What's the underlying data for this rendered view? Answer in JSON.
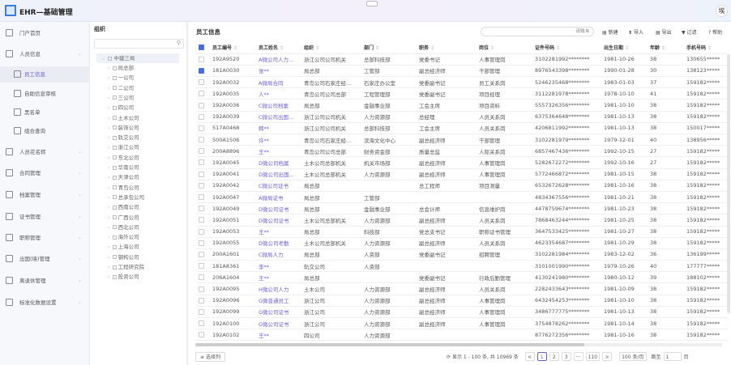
{
  "app": {
    "title": "EHR—基础管理",
    "avatar": "埃"
  },
  "sidebar": {
    "items": [
      {
        "label": "门户首页",
        "sub": false,
        "chev": false
      },
      {
        "label": "人员信息",
        "sub": false,
        "chev": true
      },
      {
        "label": "员工信息",
        "sub": true,
        "active": true
      },
      {
        "label": "自助信息审核",
        "sub": true
      },
      {
        "label": "黑名单",
        "sub": true
      },
      {
        "label": "组合查询",
        "sub": true
      },
      {
        "label": "人员花名转",
        "sub": false,
        "chev": true
      },
      {
        "label": "合同管理",
        "sub": false,
        "chev": true
      },
      {
        "label": "档案管理",
        "sub": false,
        "chev": true
      },
      {
        "label": "证书管理",
        "sub": false,
        "chev": true
      },
      {
        "label": "职称管理",
        "sub": false,
        "chev": true
      },
      {
        "label": "出国(境)管理",
        "sub": false,
        "chev": true
      },
      {
        "label": "离退休管理",
        "sub": false,
        "chev": true
      },
      {
        "label": "标准化数据设置",
        "sub": false,
        "chev": true
      }
    ]
  },
  "tree": {
    "title": "组织",
    "root": "中建三局",
    "children": [
      "局总部",
      "一公司",
      "二公司",
      "三公司",
      "四公司",
      "土木公司",
      "装饰公司",
      "轨交公司",
      "浙江公司",
      "东北公司",
      "华南公司",
      "天津公司",
      "青岛公司",
      "总承包公司",
      "西南公司",
      "广西公司",
      "西北公司",
      "海外公司",
      "上海公司",
      "钢构公司",
      "工程研究院",
      "投资公司"
    ]
  },
  "main": {
    "title": "员工信息",
    "search_placeholder": "请输入",
    "toolbar": {
      "new": "新建",
      "import": "导入",
      "export": "导出",
      "filter": "过滤",
      "help": "帮助"
    },
    "columns": [
      "员工编号",
      "员工姓名",
      "组织",
      "部门",
      "职务",
      "岗位",
      "证件号码",
      "出生日期",
      "年龄",
      "手机号码"
    ],
    "rows": [
      [
        "192A9520",
        "A微公司人力...",
        "浙江公司公司机关",
        "总部科技部",
        "党委书记",
        "人事管理岗",
        "3102281992********",
        "1981-10-26",
        "38",
        "130655*****",
        false
      ],
      [
        "181A0030",
        "张**",
        "局总部",
        "工管部",
        "副总经济师",
        "干部管理",
        "8976543398********",
        "1990-01-28",
        "30",
        "138123*****",
        true
      ],
      [
        "192A0032",
        "A微局合同",
        "青岛公司石家庄经...",
        "石家庄办公室",
        "党委副书记",
        "员工关系岗",
        "5246235468********",
        "1983-01-03",
        "37",
        "159182*****",
        false
      ],
      [
        "192A0035",
        "人**",
        "青岛公司公司总部",
        "工程管理部",
        "党委副书记",
        "项目经理",
        "3112281978********",
        "1978-10-10",
        "41",
        "159182*****",
        false
      ],
      [
        "192A0036",
        "C微公司档案",
        "局总部",
        "金融事业部",
        "工会主席",
        "项目资料",
        "5557326356********",
        "1981-10-10",
        "38",
        "159182*****",
        false
      ],
      [
        "192A0039",
        "C微公司出国...",
        "浙江公司公司机关",
        "人力资源部",
        "总经理",
        "人员关系岗",
        "6375364648********",
        "1981-10-13",
        "38",
        "159182*****",
        false
      ],
      [
        "517A0468",
        "韩**",
        "浙江公司公司机关",
        "总部科技部",
        "工会主席",
        "人员关系岗",
        "4206811992********",
        "1981-10-13",
        "38",
        "150017*****",
        false
      ],
      [
        "500A1506",
        "许**",
        "青岛公司石家庄经...",
        "滨海文化中心",
        "副总经济师",
        "干部管理",
        "3102281979********",
        "1979-12-01",
        "40",
        "138956*****",
        false
      ],
      [
        "200A8896",
        "王**",
        "青岛公司公司总部",
        "财务资金部",
        "质量总监",
        "人际关系岗",
        "6857467436********",
        "1992-10-15",
        "27",
        "159182*****",
        false
      ],
      [
        "192A0045",
        "D微公司档案",
        "土木公司总部机关",
        "机关市场部",
        "副总经济师",
        "人事管理岗",
        "5282672272********",
        "1992-10-16",
        "27",
        "159182*****",
        false
      ],
      [
        "192A0041",
        "D微公司出国...",
        "土木公司总部机关",
        "人力资源部",
        "副总经济师",
        "人事管理岗",
        "5772466872********",
        "1981-10-15",
        "38",
        "159182*****",
        false
      ],
      [
        "192A0042",
        "C微公司证书",
        "局总部",
        "",
        "总工程师",
        "项目测量",
        "6532672628********",
        "1981-10-16",
        "38",
        "159182*****",
        false
      ],
      [
        "192A0047",
        "A微局证书",
        "局总部",
        "工管部",
        "",
        "",
        "4834367556********",
        "1981-10-21",
        "38",
        "159182*****",
        false
      ],
      [
        "192A0049",
        "D微公司证书",
        "局总部",
        "金融事业部",
        "总会计师",
        "信息维护岗",
        "4478759674********",
        "1981-10-23",
        "38",
        "159182*****",
        false
      ],
      [
        "192A0051",
        "D微公司证书",
        "土木公司总部机关",
        "人力资源部",
        "副总经济师",
        "人员关系岗",
        "7868463244********",
        "1981-10-25",
        "38",
        "159182*****",
        false
      ],
      [
        "192A0053",
        "王**",
        "局总部",
        "科技部",
        "党总支书记",
        "职称证书管理",
        "3647533425********",
        "1981-10-27",
        "38",
        "159182*****",
        false
      ],
      [
        "192A0055",
        "D微公司考勤",
        "土木公司总部机关",
        "人力资源部",
        "副总经济师",
        "人员关系岗",
        "4623354687********",
        "1981-10-29",
        "38",
        "159182*****",
        false
      ],
      [
        "200A1601",
        "C微局人力",
        "局总部",
        "人资部",
        "党委副书记",
        "招聘管理",
        "3102281984********",
        "1983-12-02",
        "36",
        "136199*****",
        false
      ],
      [
        "181A8361",
        "李**",
        "轨交公司",
        "人资部",
        "",
        "",
        "3101001990********",
        "1979-10-26",
        "40",
        "177777*****",
        false
      ],
      [
        "206A1604",
        "王**",
        "局总部",
        "",
        "党委副书记",
        "行政后勤管理",
        "4130241980********",
        "1980-10-12",
        "39",
        "188102*****",
        false
      ],
      [
        "192A0095",
        "H微公司人力",
        "土木公司",
        "人力资源部",
        "副总经济师",
        "人员关系岗",
        "2282433643********",
        "1981-10-09",
        "38",
        "159182*****",
        false
      ],
      [
        "192A0096",
        "G微普通员工",
        "浙江公司",
        "人力资源部",
        "副总经济师",
        "人事管理岗",
        "6432454253********",
        "1981-10-10",
        "38",
        "159182*****",
        false
      ],
      [
        "192A0099",
        "G微公司证书",
        "浙江公司",
        "人力资源部",
        "副总经济师",
        "人事管理岗",
        "3486777775********",
        "1981-10-13",
        "38",
        "159182*****",
        false
      ],
      [
        "192A0100",
        "G微公司证书",
        "浙江公司",
        "人力资源部",
        "副总经济师",
        "人事管理岗",
        "3754878262********",
        "1981-10-14",
        "38",
        "159182*****",
        false
      ],
      [
        "192A0102",
        "王**",
        "四公司",
        "人力资源部",
        "",
        "",
        "8776272356********",
        "1981-10-16",
        "38",
        "159182*****",
        false
      ]
    ]
  },
  "footer": {
    "select_columns": "选择列",
    "summary": "显示 1 - 100 条, 共 10969 条",
    "pages": [
      "1",
      "2",
      "3",
      "···",
      "110"
    ],
    "prev": "<",
    "next": ">",
    "page_size": "100 条/页",
    "goto": "跳至",
    "goto_value": "1",
    "page_unit": "页"
  }
}
